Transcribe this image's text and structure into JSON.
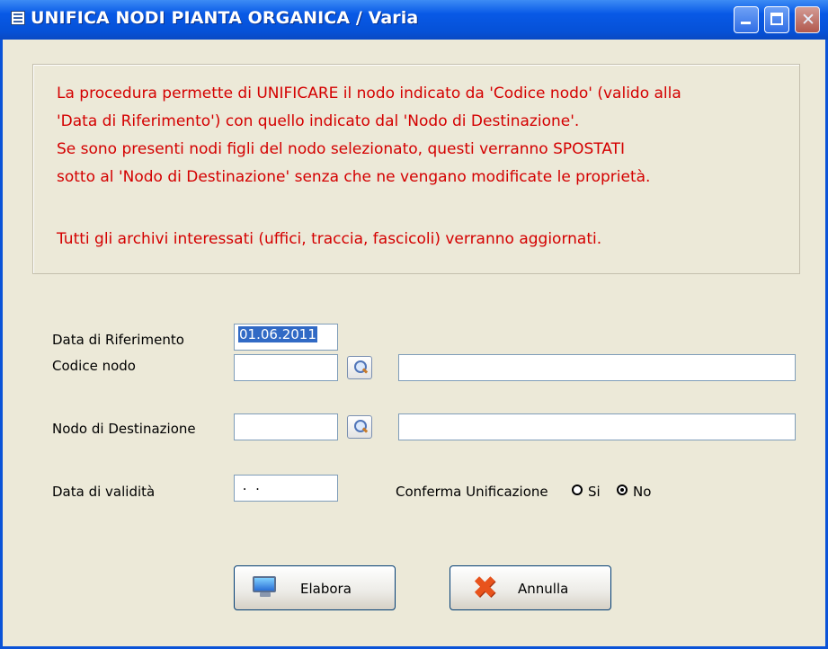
{
  "window": {
    "title": "UNIFICA NODI PIANTA ORGANICA / Varia"
  },
  "info": {
    "lines": [
      "La procedura permette di UNIFICARE il nodo indicato da 'Codice nodo' (valido alla",
      "'Data di Riferimento') con quello indicato dal 'Nodo di Destinazione'.",
      "Se sono presenti nodi figli del nodo selezionato, questi verranno SPOSTATI",
      "sotto al 'Nodo di Destinazione' senza che ne vengano modificate le proprietà.",
      "Tutti gli archivi interessati (uffici, traccia, fascicoli) verranno aggiornati."
    ],
    "color": "#d40000"
  },
  "form": {
    "data_riferimento_label": "Data di Riferimento",
    "data_riferimento_value": "01.06.2011",
    "codice_nodo_label": "Codice nodo",
    "codice_nodo_value": "",
    "codice_nodo_desc": "",
    "nodo_destinazione_label": "Nodo di Destinazione",
    "nodo_destinazione_value": "",
    "nodo_destinazione_desc": "",
    "data_validita_label": "Data di validità",
    "data_validita_value": " .  .",
    "conferma_label": "Conferma Unificazione",
    "conferma_options": [
      "Si",
      "No"
    ],
    "conferma_selected": "No"
  },
  "buttons": {
    "elabora": "Elabora",
    "annulla": "Annulla"
  },
  "icons": {
    "lookup": "magnifier-icon",
    "elabora": "monitor-icon",
    "annulla": "red-x-icon"
  }
}
